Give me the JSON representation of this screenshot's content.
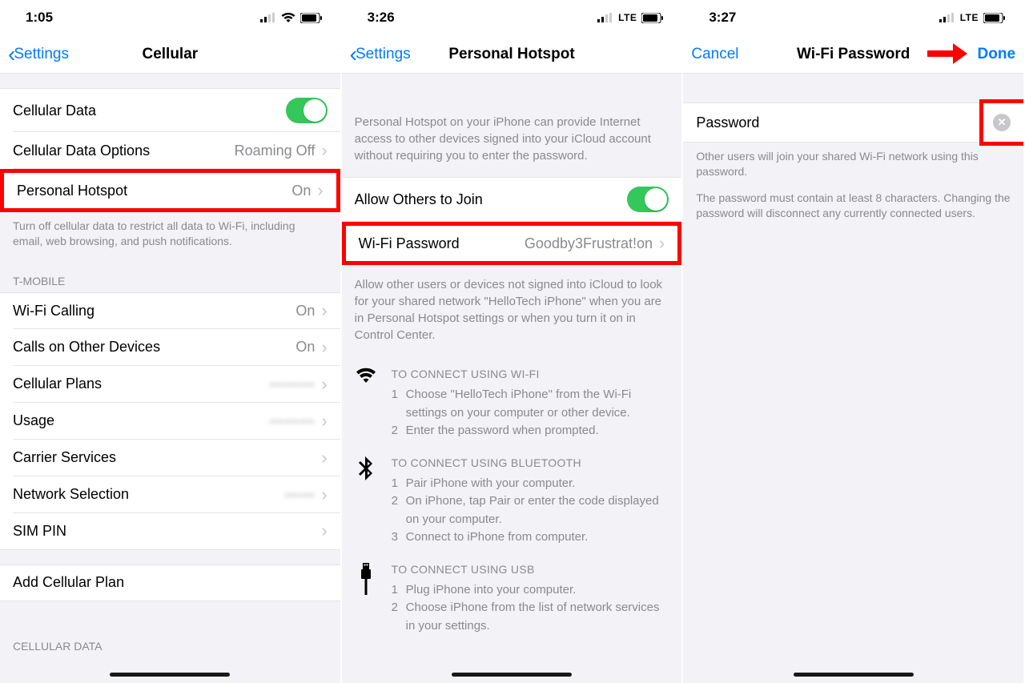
{
  "col1": {
    "time": "1:05",
    "signal": "wifi",
    "back": "Settings",
    "title": "Cellular",
    "cellularData": "Cellular Data",
    "cellularOptions": "Cellular Data Options",
    "cellularOptionsValue": "Roaming Off",
    "personalHotspot": "Personal Hotspot",
    "personalHotspotValue": "On",
    "footer1": "Turn off cellular data to restrict all data to Wi-Fi, including email, web browsing, and push notifications.",
    "carrierHeader": "T-MOBILE",
    "wifiCalling": "Wi-Fi Calling",
    "wifiCallingValue": "On",
    "callsOther": "Calls on Other Devices",
    "callsOtherValue": "On",
    "cellPlans": "Cellular Plans",
    "usage": "Usage",
    "carrierServices": "Carrier Services",
    "networkSel": "Network Selection",
    "simpin": "SIM PIN",
    "addPlan": "Add Cellular Plan",
    "bottomHeader": "CELLULAR DATA"
  },
  "col2": {
    "time": "3:26",
    "lte": "LTE",
    "back": "Settings",
    "title": "Personal Hotspot",
    "topInfo": "Personal Hotspot on your iPhone can provide Internet access to other devices signed into your iCloud account without requiring you to enter the password.",
    "allowOthers": "Allow Others to Join",
    "wifiPwLabel": "Wi-Fi Password",
    "wifiPwValue": "Goodby3Frustrat!on",
    "allowFooter": "Allow other users or devices not signed into iCloud to look for your shared network \"HelloTech iPhone\" when you are in Personal Hotspot settings or when you turn it on in Control Center.",
    "wifiTitle": "TO CONNECT USING WI-FI",
    "wifiStep1": "Choose \"HelloTech iPhone\" from the Wi-Fi settings on your computer or other device.",
    "wifiStep2": "Enter the password when prompted.",
    "btTitle": "TO CONNECT USING BLUETOOTH",
    "btStep1": "Pair iPhone with your computer.",
    "btStep2": "On iPhone, tap Pair or enter the code displayed on your computer.",
    "btStep3": "Connect to iPhone from computer.",
    "usbTitle": "TO CONNECT USING USB",
    "usbStep1": "Plug iPhone into your computer.",
    "usbStep2": "Choose iPhone from the list of network services in your settings."
  },
  "col3": {
    "time": "3:27",
    "lte": "LTE",
    "cancel": "Cancel",
    "title": "Wi-Fi Password",
    "done": "Done",
    "pwLabel": "Password",
    "footer1": "Other users will join your shared Wi-Fi network using this password.",
    "footer2": "The password must contain at least 8 characters. Changing the password will disconnect any currently connected users."
  }
}
